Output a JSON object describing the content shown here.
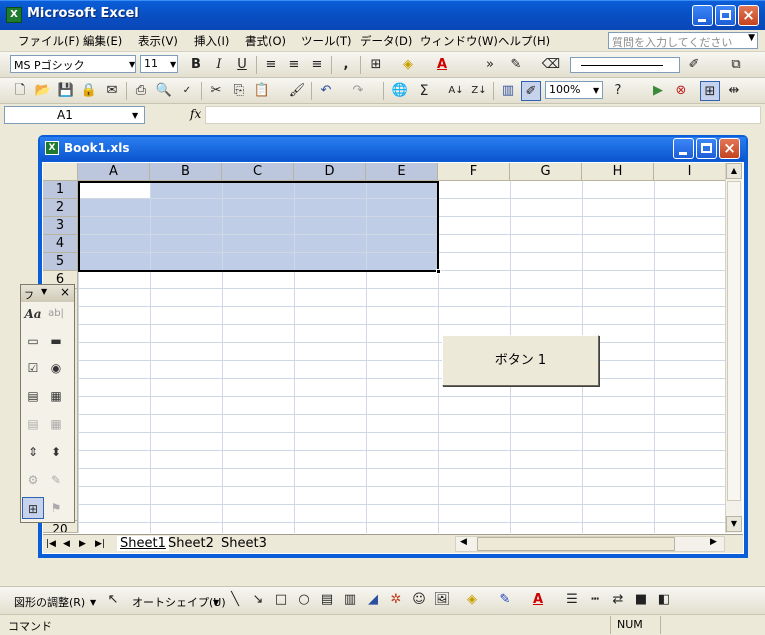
{
  "window": {
    "title": "Microsoft Excel",
    "app_icon": "X"
  },
  "menu": {
    "items": [
      "ファイル(F)",
      "編集(E)",
      "表示(V)",
      "挿入(I)",
      "書式(O)",
      "ツール(T)",
      "データ(D)",
      "ウィンドウ(W)",
      "ヘルプ(H)"
    ],
    "help_placeholder": "質問を入力してください"
  },
  "format_toolbar": {
    "font_name": "MS Pゴシック",
    "font_size": "11",
    "bold": "B",
    "italic": "I",
    "underline": "U",
    "comma": ",",
    "font_color": "A"
  },
  "standard_toolbar": {
    "sigma": "Σ",
    "zoom": "100%",
    "help": "?"
  },
  "formula_bar": {
    "name_box": "A1",
    "fx": "fx"
  },
  "workbook": {
    "title": "Book1.xls",
    "columns": [
      "A",
      "B",
      "C",
      "D",
      "E",
      "F",
      "G",
      "H",
      "I"
    ],
    "rows": [
      "1",
      "2",
      "3",
      "4",
      "5",
      "6"
    ],
    "last_row": "20",
    "selected_range": "A1:E5",
    "sheets": [
      "Sheet1",
      "Sheet2",
      "Sheet3"
    ],
    "active_sheet": "Sheet1",
    "form_button_label": "ボタン 1"
  },
  "forms_palette": {
    "title": "フ",
    "label_aa": "Aa",
    "label_ab": "ab|"
  },
  "drawing_toolbar": {
    "adjust": "図形の調整(R)",
    "autoshape": "オートシェイプ(U)"
  },
  "status": {
    "mode": "コマンド",
    "num": "NUM"
  },
  "colors": {
    "titlebar": "#0a5fd8",
    "selection": "#bfcde6",
    "header": "#ece9d8"
  }
}
